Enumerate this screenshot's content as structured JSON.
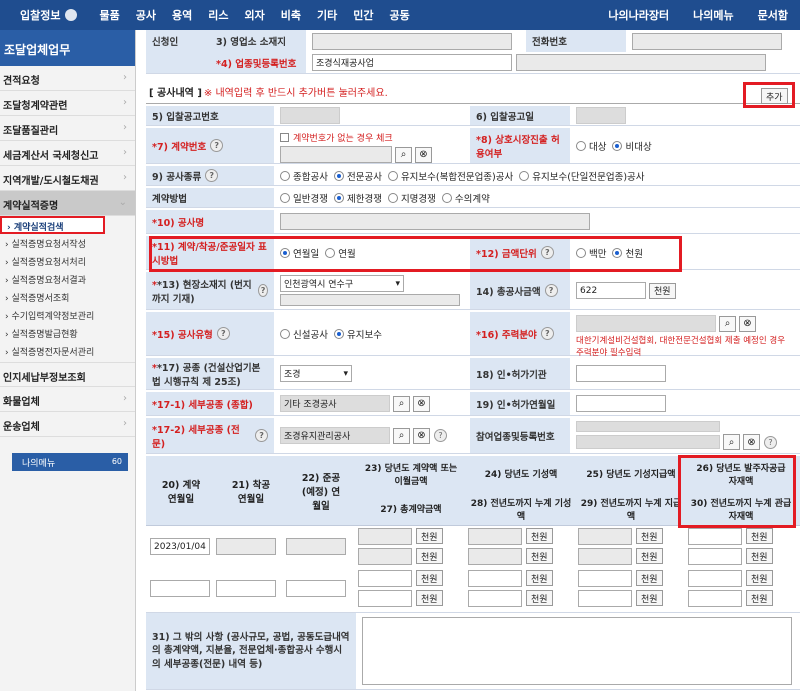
{
  "topnav": {
    "first": "입찰정보",
    "menus": [
      "물품",
      "공사",
      "용역",
      "리스",
      "외자",
      "비축",
      "기타",
      "민간",
      "공동"
    ],
    "right": [
      "나의나라장터",
      "나의메뉴",
      "문서함"
    ]
  },
  "sidebar": {
    "title": "조달업체업무",
    "items": [
      "견적요청",
      "조달청계약관련",
      "조달품질관리",
      "세금계산서 국세청신고",
      "지역개발/도시철도채권",
      "계약실적증명"
    ],
    "subs": [
      "계약실적검색",
      "실적증명요청서작성",
      "실적증명요청서처리",
      "실적증명요청서결과",
      "실적증명서조회",
      "수기입력계약정보관리",
      "실적증명발급현황",
      "실적증명전자문서관리"
    ],
    "items2": [
      "인지세납부정보조회",
      "화물업체",
      "운송업체"
    ],
    "mymenu": "나의메뉴",
    "mymenu_count": "60"
  },
  "form": {
    "r0_lbl": "신청인",
    "r0_a": "3) 영업소 소재지",
    "r0_b": "전화번호",
    "r0_c": "*4) 업종및등록번호",
    "r0_c_val": "조경식재공사업",
    "sect": "[ 공사내역 ]",
    "sect_note": "※ 내역입력 후 반드시 추가버튼 눌러주세요.",
    "add_btn": "추가",
    "f5": "5) 입찰공고번호",
    "f6": "6) 입찰공고일",
    "f7": "*7) 계약번호",
    "f7_chk": "계약번호가 없는 경우 체크",
    "f8": "*8) 상호시장진출 허용여부",
    "f8_o1": "대상",
    "f8_o2": "비대상",
    "f9": "9) 공사종류",
    "f9_opts": [
      "종합공사",
      "전문공사",
      "유지보수(복합전문업종)공사",
      "유지보수(단일전문업종)공사"
    ],
    "fcm": "계약방법",
    "fcm_opts": [
      "일반경쟁",
      "제한경쟁",
      "지명경쟁",
      "수의계약"
    ],
    "f10": "*10) 공사명",
    "f11": "*11) 계약/착공/준공일자 표시방법",
    "f11_o1": "연월일",
    "f11_o2": "연월",
    "f12": "*12) 금액단위",
    "f12_o1": "백만",
    "f12_o2": "천원",
    "f13": "*13) 현장소재지 (번지까지 기재)",
    "f13_val": "인천광역시 연수구",
    "f14": "14) 총공사금액",
    "f14_val": "622",
    "unit": "천원",
    "f15": "*15) 공사유형",
    "f15_o1": "신설공사",
    "f15_o2": "유지보수",
    "f16": "*16) 주력분야",
    "f16_note": "대한기계설비건설협회, 대한전문건설협회 제출 예정인 경우 주력분야 필수입력",
    "f17": "*17) 공종 (건설산업기본법 시행규칙 제 25조)",
    "f17_val": "조경",
    "f18": "18) 인•허가기관",
    "f171": "*17-1) 세부공종 (종합)",
    "f171_val": "기타 조경공사",
    "f19": "19) 인•허가연월일",
    "f172": "*17-2) 세부공종 (전문)",
    "f172_val": "조경유지관리공사",
    "fbiz": "참여업종및등록번호",
    "h20": "20) 계약 연월일",
    "h21": "21) 착공 연월일",
    "h22": "22) 준공 (예정) 연월일",
    "h23": "23) 당년도 계약액 또는 이월금액",
    "h24": "24) 당년도 기성액",
    "h25": "25) 당년도 기성지급액",
    "h26": "26) 당년도 발주자공급 자재액",
    "h27": "27) 총계약금액",
    "h28": "28) 전년도까지 누계 기성액",
    "h29": "29) 전년도까지 누계 지급액",
    "h30": "30) 전년도까지 누계 관급자재액",
    "date": "2023/01/04",
    "f31": "31) 그 밖의 사항 (공사규모, 공법, 공동도급내역의 총계약액, 지분율, 전문업체·종합공사 수행시의 세부공종(전문) 내역 등)"
  }
}
